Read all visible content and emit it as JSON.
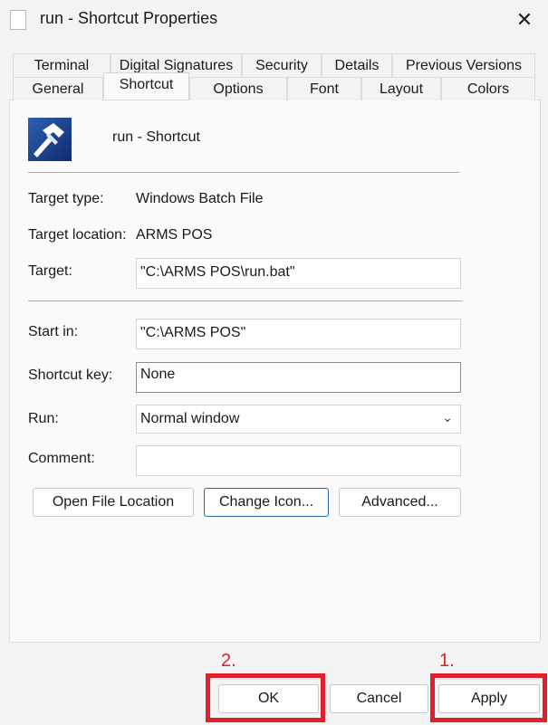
{
  "window": {
    "title": "run - Shortcut Properties",
    "close_glyph": "✕"
  },
  "tabs_row1": [
    "Terminal",
    "Digital Signatures",
    "Security",
    "Details",
    "Previous Versions"
  ],
  "tabs_row2": [
    "General",
    "Shortcut",
    "Options",
    "Font",
    "Layout",
    "Colors"
  ],
  "active_tab": "Shortcut",
  "shortcut": {
    "name": "run - Shortcut",
    "icon": "batch-file-hammer-icon"
  },
  "fields": {
    "target_type_label": "Target type:",
    "target_type_value": "Windows Batch File",
    "target_location_label": "Target location:",
    "target_location_value": "ARMS POS",
    "target_label": "Target:",
    "target_value": "\"C:\\ARMS POS\\run.bat\"",
    "start_in_label": "Start in:",
    "start_in_value": "\"C:\\ARMS POS\"",
    "shortcut_key_label": "Shortcut key:",
    "shortcut_key_value": "None",
    "run_label": "Run:",
    "run_value": "Normal window",
    "comment_label": "Comment:",
    "comment_value": ""
  },
  "buttons": {
    "open_file_location": "Open File Location",
    "change_icon": "Change Icon...",
    "advanced": "Advanced...",
    "ok": "OK",
    "cancel": "Cancel",
    "apply": "Apply"
  },
  "annotations": {
    "ok_mark": "2.",
    "apply_mark": "1.",
    "color": "#e0202a"
  }
}
